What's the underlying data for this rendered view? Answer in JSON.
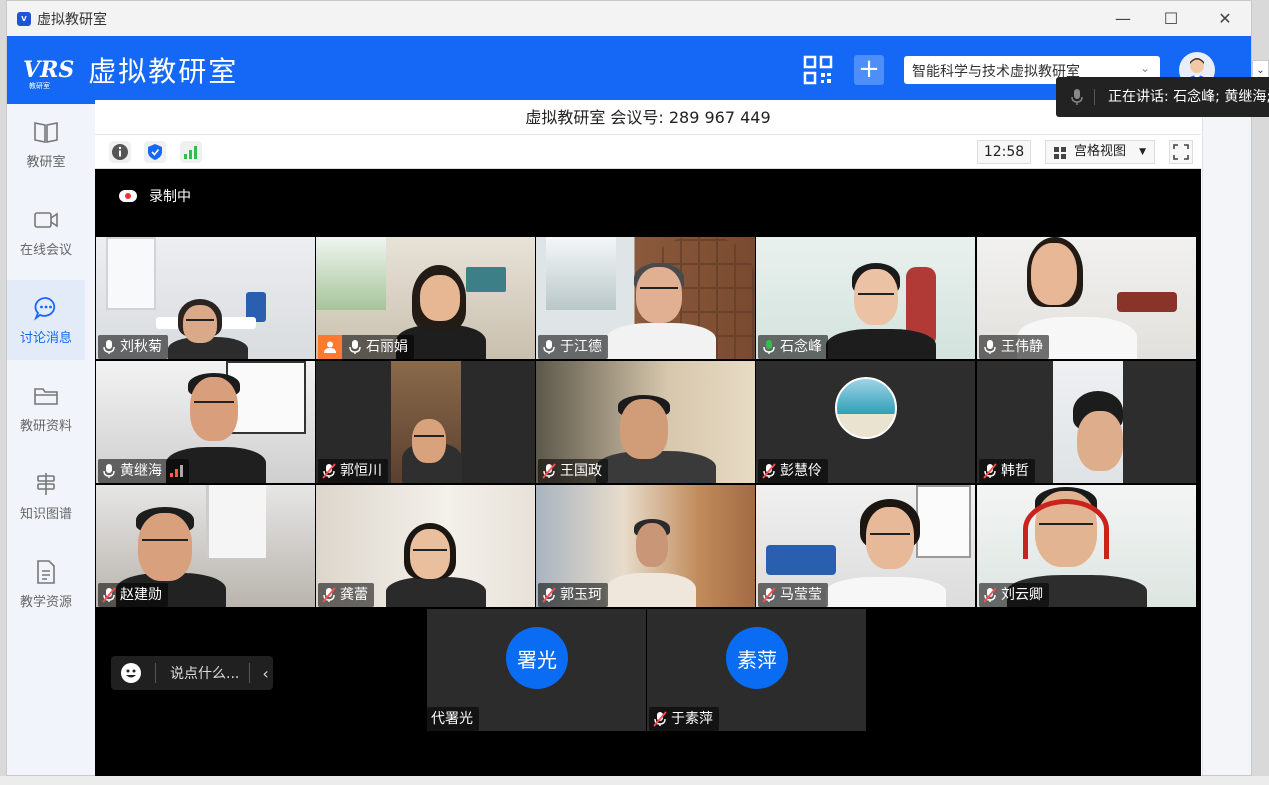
{
  "window": {
    "title": "虚拟教研室",
    "controls": [
      "minimize",
      "maximize",
      "close"
    ]
  },
  "header": {
    "logo_mark": "VRS",
    "logo_sub": "教研室",
    "app_name": "虚拟教研室",
    "org_select_value": "智能科学与技术虚拟教研室"
  },
  "sidebar": {
    "items": [
      {
        "label": "教研室",
        "icon": "book-icon"
      },
      {
        "label": "在线会议",
        "icon": "video-camera-icon"
      },
      {
        "label": "讨论消息",
        "icon": "chat-bubble-icon",
        "active": true
      },
      {
        "label": "教研资料",
        "icon": "folder-icon"
      },
      {
        "label": "知识图谱",
        "icon": "signpost-icon"
      },
      {
        "label": "教学资源",
        "icon": "document-icon"
      }
    ]
  },
  "meeting": {
    "title": "虚拟教研室 会议号:  289 967 449",
    "time": "12:58",
    "view_mode": "宫格视图",
    "recording_label": "录制中",
    "chat_placeholder": "说点什么...",
    "speaking_now": "正在讲话: 石念峰; 黄继海;",
    "participants": [
      {
        "name": "刘秋菊",
        "mic": "on"
      },
      {
        "name": "石丽娟",
        "mic": "on",
        "host": true
      },
      {
        "name": "于江德",
        "mic": "on"
      },
      {
        "name": "石念峰",
        "mic": "speaking",
        "active": true
      },
      {
        "name": "王伟静",
        "mic": "on"
      },
      {
        "name": "黄继海",
        "mic": "on",
        "signal_weak": true
      },
      {
        "name": "郭恒川",
        "mic": "muted"
      },
      {
        "name": "王国政",
        "mic": "muted"
      },
      {
        "name": "彭慧伶",
        "mic": "muted",
        "avatar_photo": true
      },
      {
        "name": "韩哲",
        "mic": "muted"
      },
      {
        "name": "赵建勋",
        "mic": "muted"
      },
      {
        "name": "龚蕾",
        "mic": "muted"
      },
      {
        "name": "郭玉珂",
        "mic": "muted"
      },
      {
        "name": "马莹莹",
        "mic": "muted"
      },
      {
        "name": "刘云卿",
        "mic": "muted"
      },
      {
        "name": "代署光",
        "initials": "署光",
        "mic": "none"
      },
      {
        "name": "于素萍",
        "initials": "素萍",
        "mic": "muted"
      }
    ]
  },
  "colors": {
    "brand": "#1568f5",
    "speaking": "#2fbf4a",
    "muted": "#ff4d4f",
    "avatar_blue": "#0a6cf2"
  }
}
